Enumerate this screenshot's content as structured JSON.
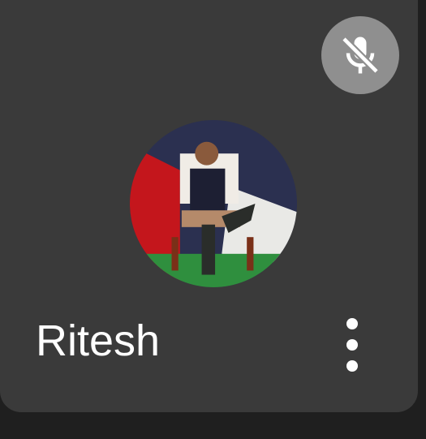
{
  "participant": {
    "name": "Ritesh",
    "avatar_icon": "avatar-photo",
    "mic_status_icon": "mic-off-icon",
    "more_options_icon": "more-vert-icon"
  },
  "colors": {
    "tile_background": "#3a3a3a",
    "page_background": "#1f1f1f",
    "mute_badge": "#8f8f8f",
    "name_text": "#ffffff"
  }
}
